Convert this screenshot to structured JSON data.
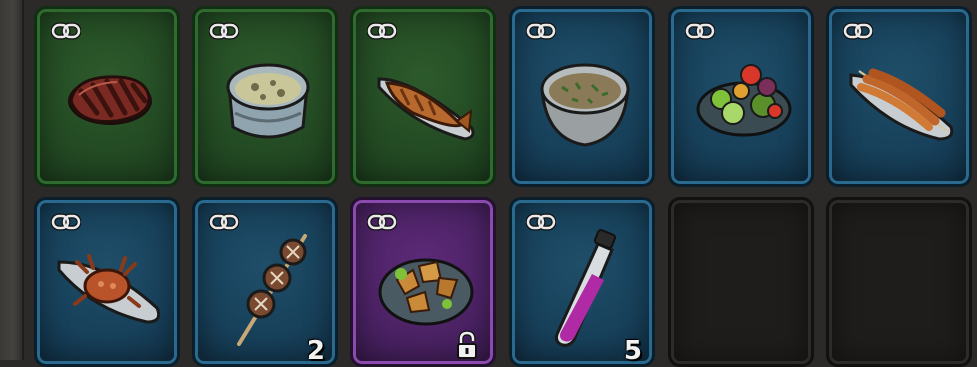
{
  "inventory": {
    "slots": [
      {
        "name": "grilled-steak",
        "rarity": "green",
        "linked": true
      },
      {
        "name": "mushroom-soup",
        "rarity": "green",
        "linked": true
      },
      {
        "name": "grilled-fish",
        "rarity": "green",
        "linked": true
      },
      {
        "name": "herb-porridge-bowl",
        "rarity": "blue",
        "linked": true
      },
      {
        "name": "fresh-salad",
        "rarity": "blue",
        "linked": true
      },
      {
        "name": "fish-skewers-platter",
        "rarity": "blue",
        "linked": true
      },
      {
        "name": "crab-dish",
        "rarity": "blue",
        "linked": true
      },
      {
        "name": "mushroom-skewer",
        "rarity": "blue",
        "linked": true,
        "count": "2"
      },
      {
        "name": "fried-meat-platter",
        "rarity": "purple",
        "linked": true,
        "locked": true
      },
      {
        "name": "potion-vial",
        "rarity": "blue",
        "linked": true,
        "count": "5"
      },
      {
        "name": "empty-slot",
        "rarity": "empty"
      },
      {
        "name": "empty-slot",
        "rarity": "empty"
      }
    ]
  },
  "colors": {
    "green": "#234a23",
    "blue": "#17405a",
    "purple": "#4b2264",
    "empty": "#1e1d1b"
  },
  "icons": {
    "link": "link-icon",
    "lock": "lock-icon"
  }
}
